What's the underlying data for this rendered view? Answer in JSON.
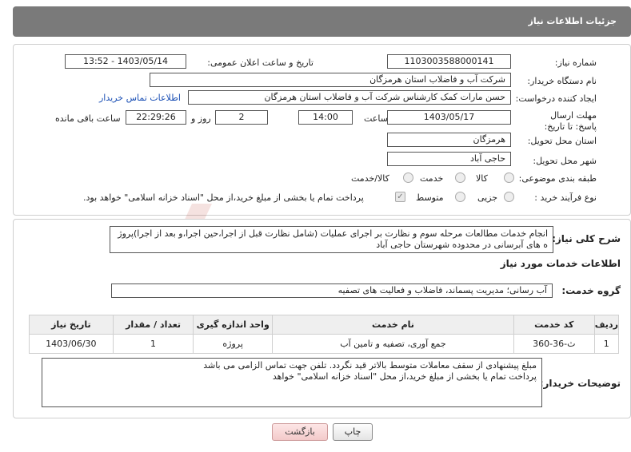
{
  "header": {
    "title": "جزئیات اطلاعات نیاز"
  },
  "info": {
    "need_number_label": "شماره نیاز:",
    "need_number": "1103003588000141",
    "announce_label": "تاریخ و ساعت اعلان عمومی:",
    "announce_value": "1403/05/14 - 13:52",
    "buyer_org_label": "نام دستگاه خریدار:",
    "buyer_org": "شرکت آب و فاضلاب استان هرمزگان",
    "creator_label": "ایجاد کننده درخواست:",
    "creator": "حسن مارات کمک کارشناس شرکت آب و فاضلاب استان هرمزگان",
    "contact_link": "اطلاعات تماس خریدار",
    "deadline_label": "مهلت ارسال پاسخ: تا تاریخ:",
    "deadline_date": "1403/05/17",
    "time_label": "ساعت",
    "deadline_time": "14:00",
    "days_value": "2",
    "days_label": "روز و",
    "remaining_time": "22:29:26",
    "remaining_label": "ساعت باقی مانده",
    "province_label": "استان محل تحویل:",
    "province": "هرمزگان",
    "city_label": "شهر محل تحویل:",
    "city": "حاجی آباد",
    "category_label": "طبقه بندی موضوعی:",
    "category_options": [
      "کالا",
      "خدمت",
      "کالا/خدمت"
    ],
    "process_label": "نوع فرآیند خرید :",
    "process_options": [
      "جزیی",
      "متوسط"
    ],
    "treasury_text": "پرداخت تمام یا بخشی از مبلغ خرید،از محل \"اسناد خزانه اسلامی\" خواهد بود."
  },
  "description": {
    "summary_label": "شرح کلی نیاز:",
    "summary": "انجام خدمات مطالعات مرحله سوم و نظارت بر اجرای عملیات (شامل نظارت قبل از اجرا،حین اجرا،و بعد از اجرا)پروژ ه های آبرسانی در محدوده شهرستان حاجی آباد",
    "services_title": "اطلاعات خدمات مورد نیاز",
    "service_group_label": "گروه خدمت:",
    "service_group": "آب رسانی؛ مدیریت پسماند، فاضلاب و فعالیت های تصفیه",
    "table_headers": [
      "ردیف",
      "کد خدمت",
      "نام خدمت",
      "واحد اندازه گیری",
      "تعداد / مقدار",
      "تاریخ نیاز"
    ],
    "table_rows": [
      [
        "1",
        "ث-36-360",
        "جمع آوری، تصفیه و تامین آب",
        "پروژه",
        "1",
        "1403/06/30"
      ]
    ],
    "buyer_notes_label": "توضیحات خریدار:",
    "buyer_notes_line1": "مبلغ پیشنهادی از سقف معاملات متوسط بالاتر قید نگردد. تلفن جهت تماس الزامی می باشد",
    "buyer_notes_line2": "پرداخت تمام یا بخشی از مبلغ خرید،از محل \"اسناد خزانه اسلامی\" خواهد"
  },
  "buttons": {
    "print": "چاپ",
    "back": "بازگشت"
  },
  "watermark": {
    "text": "AriaTender.neT"
  },
  "colors": {
    "header_bg": "#7a7a7a",
    "link": "#1a4fb5",
    "back_btn": "#f3caca"
  }
}
